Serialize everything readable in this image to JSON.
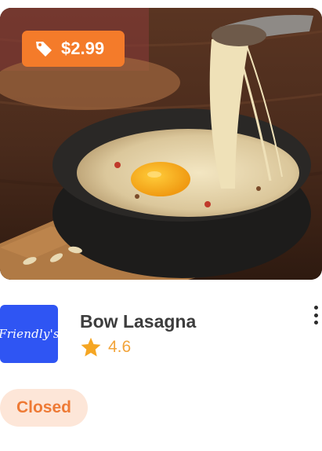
{
  "item": {
    "price": "$2.99",
    "name": "Bow Lasagna",
    "rating": "4.6",
    "logo_text": "Friendly's",
    "status": "Closed"
  },
  "colors": {
    "price_badge": "#f47b2a",
    "logo_background": "#2f55f3",
    "star": "#f5a623",
    "status_background": "#fde6d8",
    "status_text": "#ee7a35"
  },
  "icons": {
    "price": "tag-icon",
    "rating": "star-icon",
    "menu": "more-vertical-icon"
  }
}
